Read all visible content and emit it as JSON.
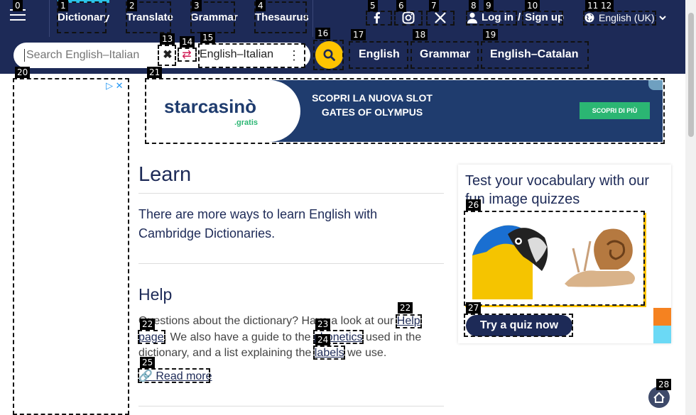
{
  "header": {
    "nav": [
      "Dictionary",
      "Translate",
      "Grammar",
      "Thesaurus"
    ],
    "login_label": "Log in",
    "login_sep": "/",
    "signup_label": "Sign up",
    "language_label": "English (UK)"
  },
  "search": {
    "placeholder": "Search English–Italian",
    "dictionary_label": "English–Italian",
    "pills": [
      "English",
      "Grammar",
      "English–Catalan"
    ]
  },
  "ad": {
    "logo": "starcasinò",
    "logo_sub": ".gratis",
    "text": "SCOPRI LA NUOVA SLOT GATES OF OLYMPUS",
    "button": "SCOPRI DI PIÙ"
  },
  "learn": {
    "title": "Learn",
    "text": "There are more ways to learn English with Cambridge Dictionaries."
  },
  "help": {
    "title": "Help",
    "text_1": "Questions about the dictionary? Have a look at our ",
    "link_help": "Help page",
    "text_2": ". We also have a guide to the ",
    "link_phonetics": "phonetics",
    "text_3": " used in the dictionary, and a list explaining the ",
    "link_labels": "labels",
    "text_4": " we use.",
    "read_more": "Read more"
  },
  "quiz": {
    "title": "Test your vocabulary with our fun image quizzes",
    "button": "Try a quiz now"
  },
  "tags": [
    "0",
    "1",
    "2",
    "3",
    "4",
    "5",
    "6",
    "7",
    "8",
    "9",
    "10",
    "11",
    "12",
    "13",
    "14",
    "15",
    "16",
    "17",
    "18",
    "19",
    "20",
    "21",
    "22",
    "22",
    "23",
    "24",
    "25",
    "26",
    "27",
    "28"
  ],
  "colors": {
    "navy": "#1d2a57",
    "yellow": "#fec400",
    "accent_cyan": "#2bc3e8",
    "swap_red": "#d11a53",
    "ad_green": "#2bb673"
  }
}
